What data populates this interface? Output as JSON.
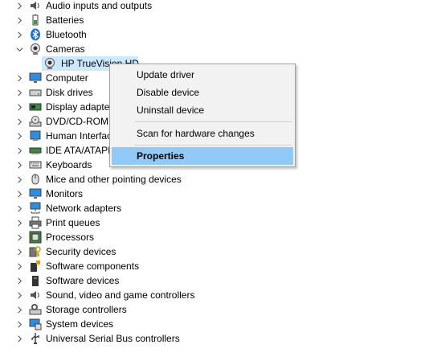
{
  "tree": {
    "items": [
      {
        "label": "Audio inputs and outputs",
        "icon": "speaker-icon",
        "expanded": false
      },
      {
        "label": "Batteries",
        "icon": "battery-icon",
        "expanded": false
      },
      {
        "label": "Bluetooth",
        "icon": "bluetooth-icon",
        "expanded": false
      },
      {
        "label": "Cameras",
        "icon": "camera-icon",
        "expanded": true
      },
      {
        "label": "HP TrueVision HD",
        "icon": "webcam-icon",
        "child": true,
        "selected": true
      },
      {
        "label": "Computer",
        "icon": "monitor-icon",
        "expanded": false
      },
      {
        "label": "Disk drives",
        "icon": "disk-icon",
        "expanded": false
      },
      {
        "label": "Display adapters",
        "icon": "display-adapter-icon",
        "expanded": false
      },
      {
        "label": "DVD/CD-ROM drives",
        "icon": "dvd-icon",
        "expanded": false
      },
      {
        "label": "Human Interface Devices",
        "icon": "hid-icon",
        "expanded": false
      },
      {
        "label": "IDE ATA/ATAPI controllers",
        "icon": "ide-icon",
        "expanded": false
      },
      {
        "label": "Keyboards",
        "icon": "keyboard-icon",
        "expanded": false
      },
      {
        "label": "Mice and other pointing devices",
        "icon": "mouse-icon",
        "expanded": false
      },
      {
        "label": "Monitors",
        "icon": "monitor-icon",
        "expanded": false
      },
      {
        "label": "Network adapters",
        "icon": "network-icon",
        "expanded": false
      },
      {
        "label": "Print queues",
        "icon": "printer-icon",
        "expanded": false
      },
      {
        "label": "Processors",
        "icon": "processor-icon",
        "expanded": false
      },
      {
        "label": "Security devices",
        "icon": "security-icon",
        "expanded": false
      },
      {
        "label": "Software components",
        "icon": "software-component-icon",
        "expanded": false
      },
      {
        "label": "Software devices",
        "icon": "software-device-icon",
        "expanded": false
      },
      {
        "label": "Sound, video and game controllers",
        "icon": "sound-icon",
        "expanded": false
      },
      {
        "label": "Storage controllers",
        "icon": "storage-icon",
        "expanded": false
      },
      {
        "label": "System devices",
        "icon": "system-icon",
        "expanded": false
      },
      {
        "label": "Universal Serial Bus controllers",
        "icon": "usb-icon",
        "expanded": false
      }
    ]
  },
  "context_menu": {
    "items": [
      {
        "label": "Update driver"
      },
      {
        "label": "Disable device"
      },
      {
        "label": "Uninstall device"
      },
      {
        "label": "Scan for hardware changes"
      },
      {
        "label": "Properties",
        "highlighted": true,
        "bold": true
      }
    ]
  },
  "colors": {
    "selection": "#cce8ff",
    "menu_highlight": "#91c9f7",
    "menu_bg": "#f2f2f2"
  }
}
